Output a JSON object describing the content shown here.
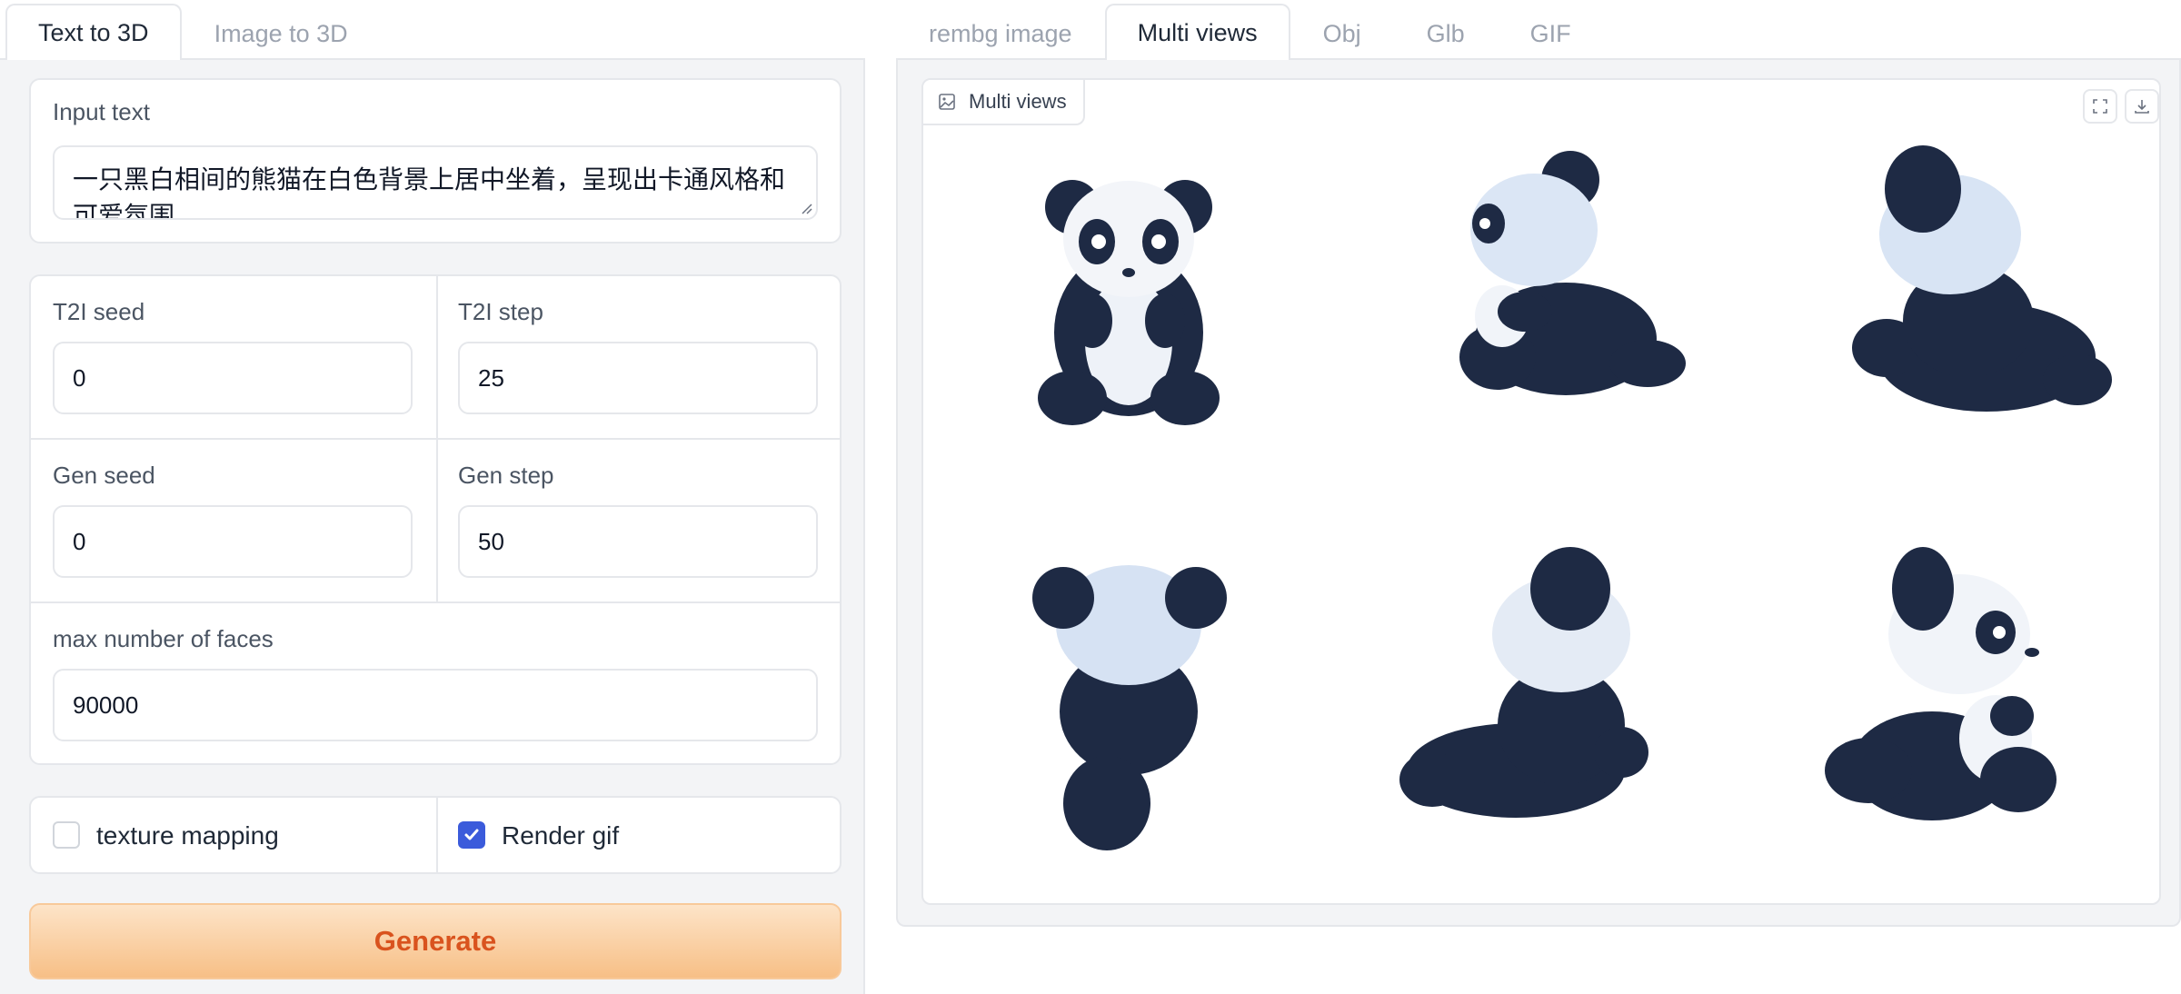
{
  "left_tabs": [
    {
      "label": "Text to 3D",
      "active": true
    },
    {
      "label": "Image to 3D",
      "active": false
    }
  ],
  "right_tabs": [
    {
      "label": "rembg image",
      "active": false
    },
    {
      "label": "Multi views",
      "active": true
    },
    {
      "label": "Obj",
      "active": false
    },
    {
      "label": "Glb",
      "active": false
    },
    {
      "label": "GIF",
      "active": false
    }
  ],
  "input_text": {
    "label": "Input text",
    "value": "一只黑白相间的熊猫在白色背景上居中坐着，呈现出卡通风格和可爱氛围"
  },
  "t2i_seed": {
    "label": "T2I seed",
    "value": "0"
  },
  "t2i_step": {
    "label": "T2I step",
    "value": "25"
  },
  "gen_seed": {
    "label": "Gen seed",
    "value": "0"
  },
  "gen_step": {
    "label": "Gen step",
    "value": "50"
  },
  "max_faces": {
    "label": "max number of faces",
    "value": "90000"
  },
  "texture_mapping": {
    "label": "texture mapping",
    "checked": false
  },
  "render_gif": {
    "label": "Render gif",
    "checked": true
  },
  "generate_label": "Generate",
  "gallery": {
    "label": "Multi views",
    "icons": [
      "image-icon",
      "fullscreen-icon",
      "download-icon"
    ]
  },
  "colors": {
    "accent": "#3b5bdb",
    "generate_text": "#d9531e",
    "generate_bg": "#f7bf86",
    "panda_dark": "#1e2a44",
    "panda_light": "#e8eef8"
  }
}
